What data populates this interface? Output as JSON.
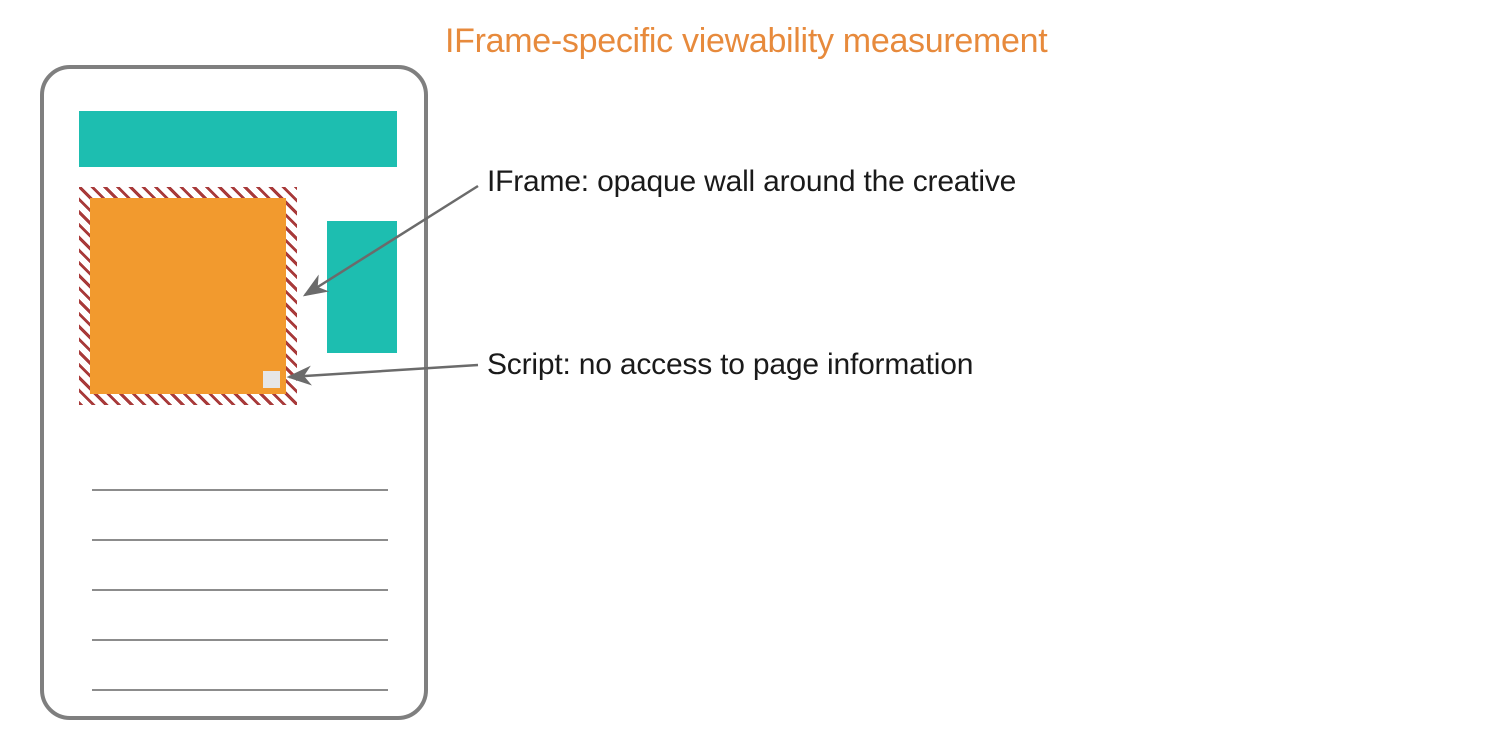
{
  "title": "IFrame-specific viewability measurement",
  "annotations": {
    "iframe": "IFrame: opaque wall around the creative",
    "script": "Script: no access to page information"
  },
  "colors": {
    "title": "#e78a3c",
    "teal": "#1dbeb0",
    "orange": "#f29a2e",
    "hatch": "#a83a3a",
    "phone_border": "#7f7f7f",
    "line": "#8c8c8c",
    "text": "#1a1a1a",
    "script_dot": "#e6e6e6"
  },
  "diagram": {
    "phone": {
      "lines": 5
    },
    "elements": [
      "header-bar",
      "iframe-box",
      "orange-creative",
      "script-dot",
      "side-bar"
    ]
  }
}
